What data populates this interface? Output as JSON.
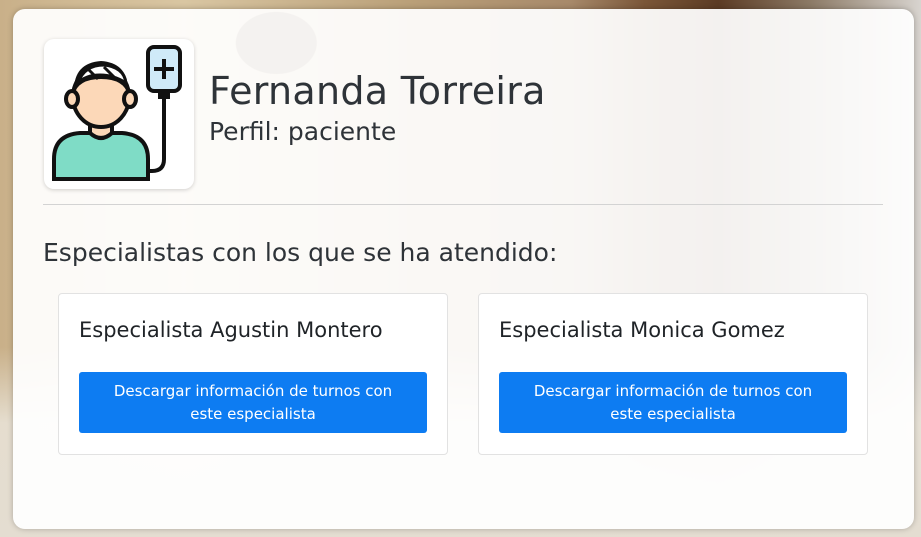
{
  "profile": {
    "name": "Fernanda Torreira",
    "role": "Perfil: paciente",
    "avatar_icon": "patient-with-iv-drip-icon"
  },
  "specialists_section": {
    "title": "Especialistas con los que se ha atendido:",
    "specialists": [
      {
        "name": "Especialista Agustin Montero",
        "button_label": "Descargar información de turnos con este especialista"
      },
      {
        "name": "Especialista Monica Gomez",
        "button_label": "Descargar información de turnos con este especialista"
      }
    ]
  },
  "colors": {
    "primary_button": "#0d7cf2",
    "text": "#2e3338",
    "avatar_shirt": "#7fdcc6",
    "avatar_skin": "#fcd8b8",
    "iv_bag": "#cfeaf8"
  }
}
